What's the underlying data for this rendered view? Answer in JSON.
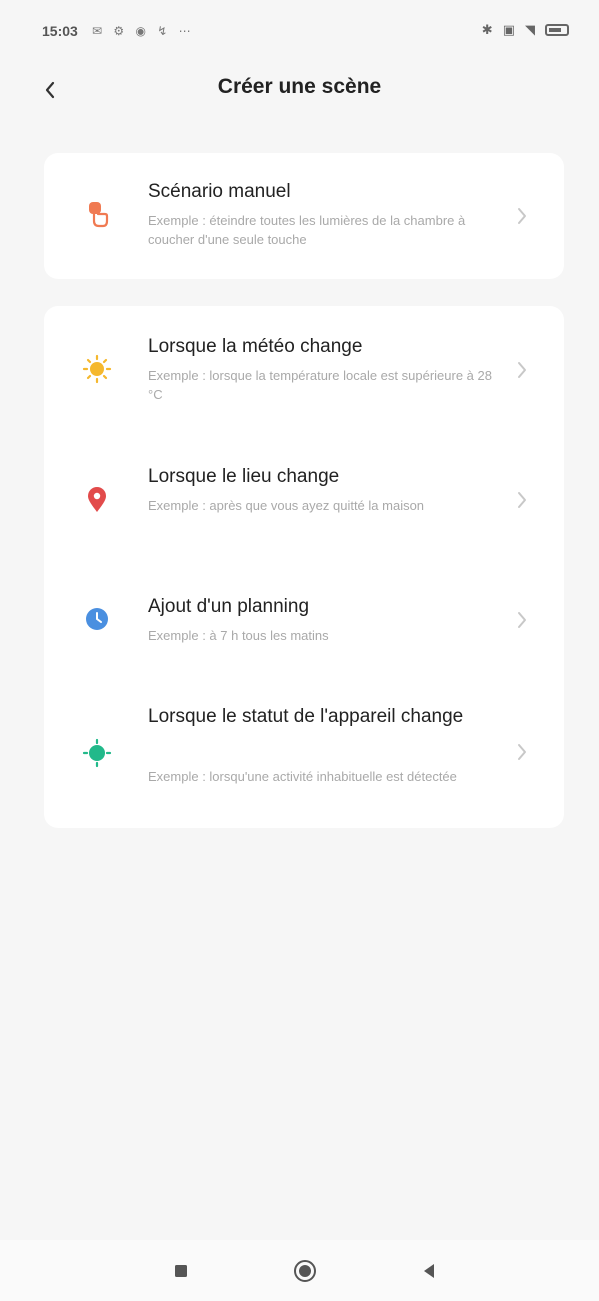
{
  "status_bar": {
    "time": "15:03",
    "left_icons": "✉ ⚙ ◉ ↯ ⋯",
    "right_icons": [
      "✱",
      "▣",
      "◥"
    ]
  },
  "header": {
    "title": "Créer une scène"
  },
  "card1": {
    "items": [
      {
        "title": "Scénario manuel",
        "desc": "Exemple : éteindre toutes les lumières de la chambre à coucher d'une seule touche",
        "icon": "hand-tap-icon",
        "icon_color": "#f07a52"
      }
    ]
  },
  "card2": {
    "items": [
      {
        "title": "Lorsque la météo change",
        "desc": "Exemple : lorsque la température locale est supérieure à 28 °C",
        "icon": "sun-icon",
        "icon_color": "#f5b82e"
      },
      {
        "title": "Lorsque le lieu change",
        "desc": "Exemple : après que vous ayez quitté la maison",
        "icon": "location-pin-icon",
        "icon_color": "#e24b4b"
      },
      {
        "title": "Ajout d'un planning",
        "desc": "Exemple : à 7 h tous les matins",
        "icon": "clock-icon",
        "icon_color": "#4a8fe0"
      },
      {
        "title": "Lorsque le statut de l'appareil change",
        "desc": "Exemple : lorsqu'une activité inhabituelle est détectée",
        "icon": "device-status-icon",
        "icon_color": "#22b98a"
      }
    ]
  },
  "colors": {
    "background": "#f6f6f6",
    "card": "#ffffff",
    "title": "#222222",
    "description": "#a9a9a9",
    "chevron": "#c8c8c8"
  }
}
